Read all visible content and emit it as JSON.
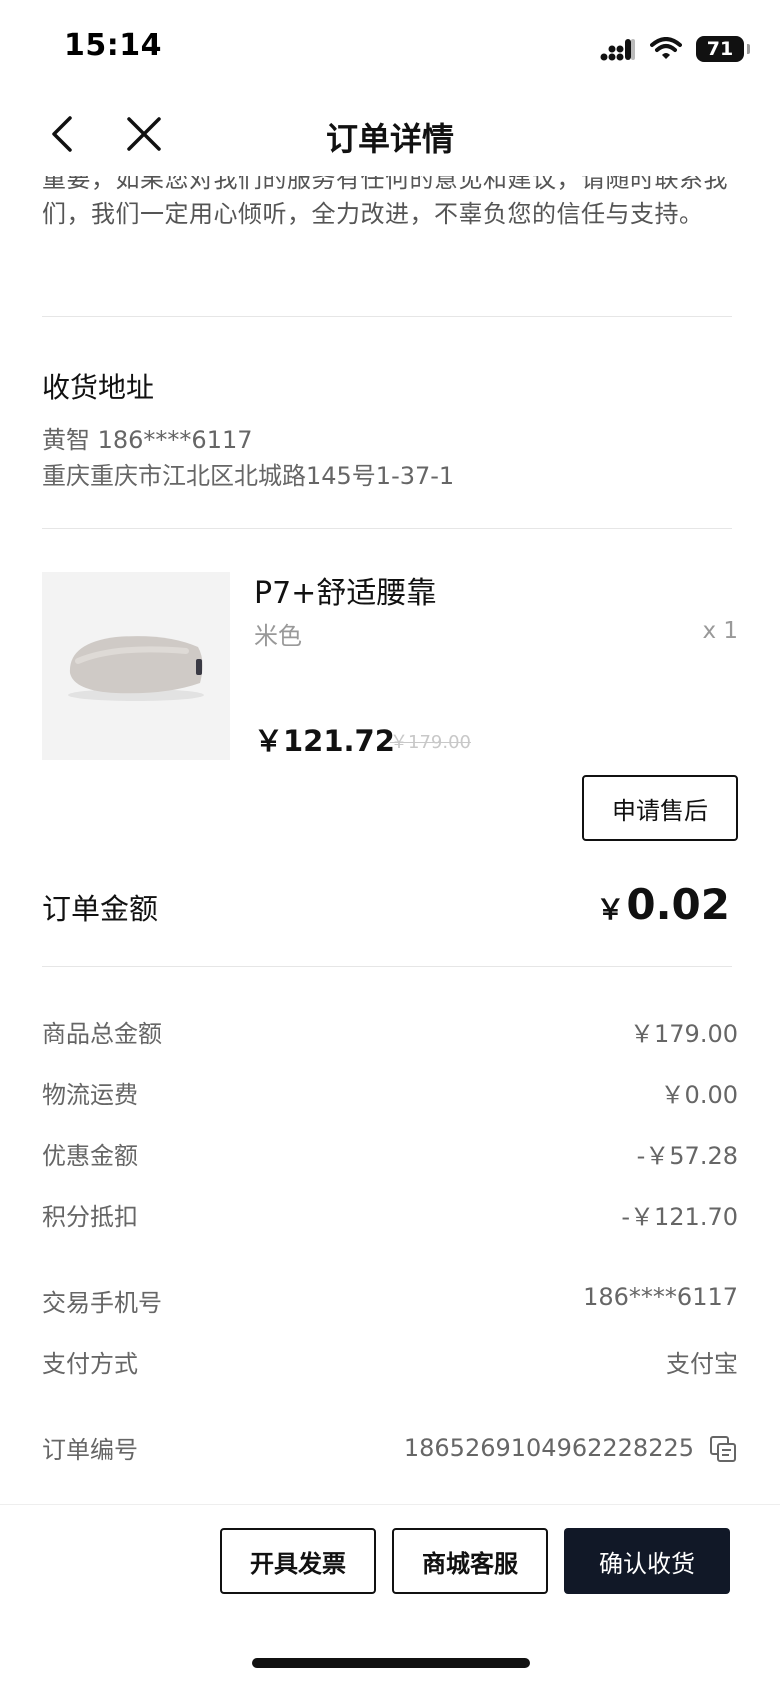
{
  "status_bar": {
    "time": "15:14",
    "battery": "71"
  },
  "nav": {
    "title": "订单详情",
    "back_icon": "chevron-left-icon",
    "close_icon": "close-icon"
  },
  "notice": {
    "text": "重要，如果您对我们的服务有任何的意见和建议，请随时联系我们，我们一定用心倾听，全力改进，不辜负您的信任与支持。"
  },
  "address": {
    "title": "收货地址",
    "name_phone": "黄智  186****6117",
    "address": "重庆重庆市江北区北城路145号1-37-1"
  },
  "product": {
    "name": "P7+舒适腰靠",
    "variant": "米色",
    "quantity": "x 1",
    "price": "￥121.72",
    "original_price": "￥179.00",
    "after_sale_label": "申请售后"
  },
  "order_total": {
    "label": "订单金额",
    "currency": "￥",
    "amount": "0.02"
  },
  "price_rows": [
    {
      "label": "商品总金额",
      "value": "￥179.00"
    },
    {
      "label": "物流运费",
      "value": "￥0.00"
    },
    {
      "label": "优惠金额",
      "value": "-￥57.28"
    },
    {
      "label": "积分抵扣",
      "value": "-￥121.70"
    }
  ],
  "info_rows": [
    {
      "label": "交易手机号",
      "value": "186****6117"
    },
    {
      "label": "支付方式",
      "value": "支付宝"
    },
    {
      "label": "订单编号",
      "value": "1865269104962228225"
    }
  ],
  "bottom_bar": {
    "invoice_label": "开具发票",
    "service_label": "商城客服",
    "confirm_label": "确认收货"
  },
  "colors": {
    "primary_dark": "#111827",
    "text_secondary": "#666666",
    "divider": "#e6e6e6"
  }
}
